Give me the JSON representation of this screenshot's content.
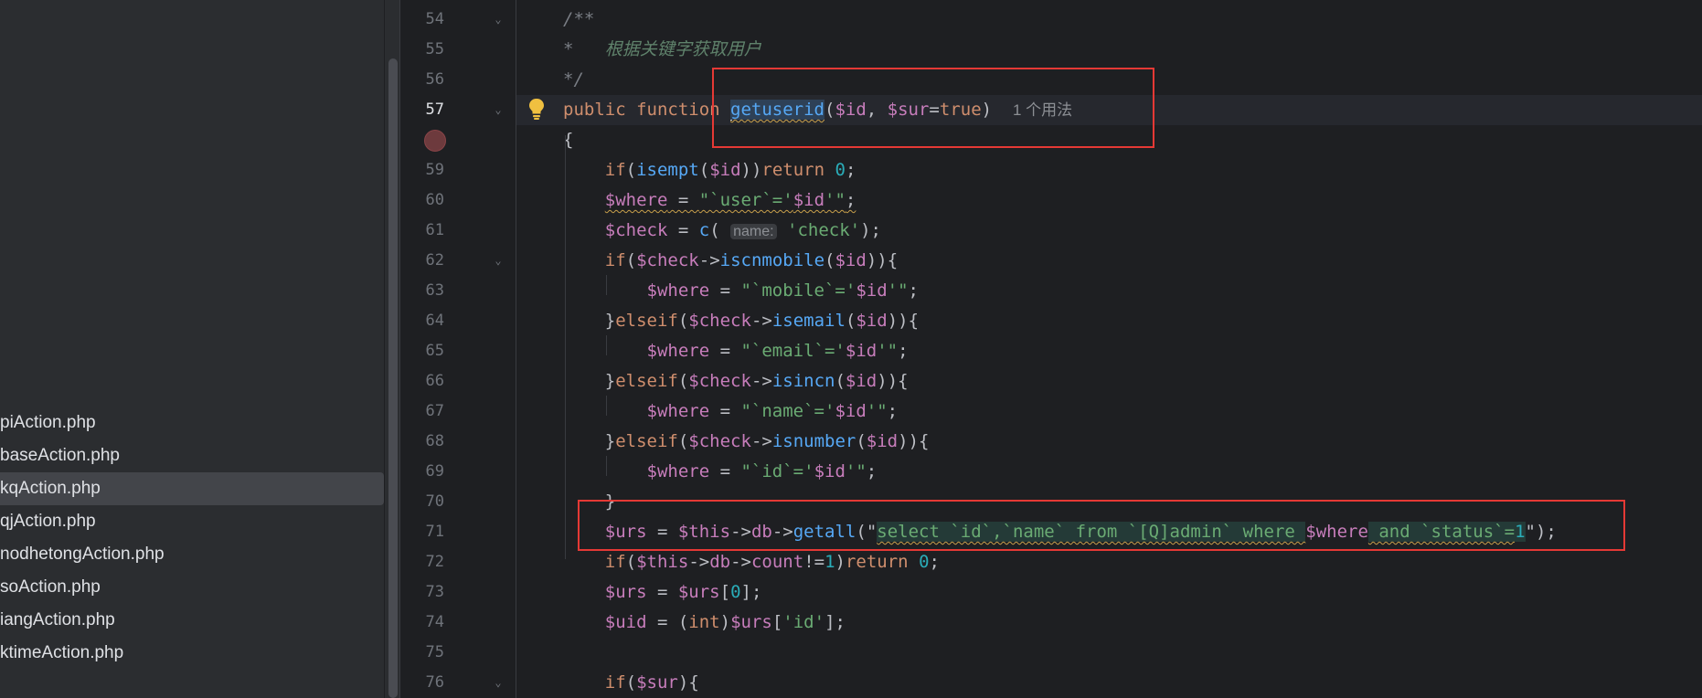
{
  "files": [
    {
      "label": "piAction.php",
      "selected": false
    },
    {
      "label": "baseAction.php",
      "selected": false
    },
    {
      "label": "kqAction.php",
      "selected": true
    },
    {
      "label": "qjAction.php",
      "selected": false
    },
    {
      "label": "nodhetongAction.php",
      "selected": false
    },
    {
      "label": "soAction.php",
      "selected": false
    },
    {
      "label": "iangAction.php",
      "selected": false
    },
    {
      "label": "ktimeAction.php",
      "selected": false
    }
  ],
  "current_line": "57",
  "lines": [
    {
      "n": "54",
      "fold": "⌄",
      "tokens": [
        [
          "cm",
          "/**"
        ]
      ]
    },
    {
      "n": "55",
      "fold": "",
      "tokens": [
        [
          "cm",
          "*   "
        ],
        [
          "cmz",
          "根据关键字获取用户"
        ]
      ]
    },
    {
      "n": "56",
      "fold": "",
      "tokens": [
        [
          "cm",
          "*/"
        ]
      ]
    },
    {
      "n": "57",
      "fold": "⌄",
      "tokens": [
        [
          "kw",
          "public "
        ],
        [
          "kw",
          "function "
        ],
        [
          "caret",
          ""
        ],
        [
          "fn hl-ident wavy",
          "getuserid"
        ],
        [
          "pl",
          "("
        ],
        [
          "vr",
          "$id"
        ],
        [
          "pl",
          ", "
        ],
        [
          "vr",
          "$sur"
        ],
        [
          "pl",
          "="
        ],
        [
          "kw",
          "true"
        ],
        [
          "pl",
          ")  "
        ],
        [
          "usage",
          "1 个用法"
        ]
      ]
    },
    {
      "n": "",
      "fold": "",
      "tokens": [
        [
          "pl",
          "{"
        ]
      ]
    },
    {
      "n": "59",
      "fold": "",
      "tokens": [
        [
          "pl",
          "    "
        ],
        [
          "kw",
          "if"
        ],
        [
          "pl",
          "("
        ],
        [
          "fn",
          "isempt"
        ],
        [
          "pl",
          "("
        ],
        [
          "vr",
          "$id"
        ],
        [
          "pl",
          "))"
        ],
        [
          "kw",
          "return "
        ],
        [
          "nm",
          "0"
        ],
        [
          "pl",
          ";"
        ]
      ]
    },
    {
      "n": "60",
      "fold": "",
      "tokens": [
        [
          "pl",
          "    "
        ],
        [
          "vr wavy",
          "$where"
        ],
        [
          "pl wavy",
          " = "
        ],
        [
          "st wavy",
          "\"`user`='"
        ],
        [
          "vr wavy",
          "$id"
        ],
        [
          "st wavy",
          "'\""
        ],
        [
          "pl wavy",
          ";"
        ]
      ]
    },
    {
      "n": "61",
      "fold": "",
      "tokens": [
        [
          "pl",
          "    "
        ],
        [
          "vr",
          "$check"
        ],
        [
          "pl",
          " = "
        ],
        [
          "fn",
          "c"
        ],
        [
          "pl",
          "( "
        ],
        [
          "hint",
          "name:"
        ],
        [
          "pl",
          " "
        ],
        [
          "st",
          "'check'"
        ],
        [
          "pl",
          ");"
        ]
      ]
    },
    {
      "n": "62",
      "fold": "⌄",
      "tokens": [
        [
          "pl",
          "    "
        ],
        [
          "kw",
          "if"
        ],
        [
          "pl",
          "("
        ],
        [
          "vr",
          "$check"
        ],
        [
          "pl",
          "->"
        ],
        [
          "fn",
          "iscnmobile"
        ],
        [
          "pl",
          "("
        ],
        [
          "vr",
          "$id"
        ],
        [
          "pl",
          "))"
        ],
        [
          "pl",
          "{"
        ]
      ]
    },
    {
      "n": "63",
      "fold": "",
      "tokens": [
        [
          "pl",
          "        "
        ],
        [
          "vr",
          "$where"
        ],
        [
          "pl",
          " = "
        ],
        [
          "st",
          "\"`mobile`='"
        ],
        [
          "vr",
          "$id"
        ],
        [
          "st",
          "'\""
        ],
        [
          "pl",
          ";"
        ]
      ]
    },
    {
      "n": "64",
      "fold": "",
      "tokens": [
        [
          "pl",
          "    }"
        ],
        [
          "kw",
          "elseif"
        ],
        [
          "pl",
          "("
        ],
        [
          "vr",
          "$check"
        ],
        [
          "pl",
          "->"
        ],
        [
          "fn",
          "isemail"
        ],
        [
          "pl",
          "("
        ],
        [
          "vr",
          "$id"
        ],
        [
          "pl",
          "))"
        ],
        [
          "pl",
          "{"
        ]
      ]
    },
    {
      "n": "65",
      "fold": "",
      "tokens": [
        [
          "pl",
          "        "
        ],
        [
          "vr",
          "$where"
        ],
        [
          "pl",
          " = "
        ],
        [
          "st",
          "\"`email`='"
        ],
        [
          "vr",
          "$id"
        ],
        [
          "st",
          "'\""
        ],
        [
          "pl",
          ";"
        ]
      ]
    },
    {
      "n": "66",
      "fold": "",
      "tokens": [
        [
          "pl",
          "    }"
        ],
        [
          "kw",
          "elseif"
        ],
        [
          "pl",
          "("
        ],
        [
          "vr",
          "$check"
        ],
        [
          "pl",
          "->"
        ],
        [
          "fn",
          "isincn"
        ],
        [
          "pl",
          "("
        ],
        [
          "vr",
          "$id"
        ],
        [
          "pl",
          "))"
        ],
        [
          "pl",
          "{"
        ]
      ]
    },
    {
      "n": "67",
      "fold": "",
      "tokens": [
        [
          "pl",
          "        "
        ],
        [
          "vr",
          "$where"
        ],
        [
          "pl",
          " = "
        ],
        [
          "st",
          "\"`name`='"
        ],
        [
          "vr",
          "$id"
        ],
        [
          "st",
          "'\""
        ],
        [
          "pl",
          ";"
        ]
      ]
    },
    {
      "n": "68",
      "fold": "",
      "tokens": [
        [
          "pl",
          "    }"
        ],
        [
          "kw",
          "elseif"
        ],
        [
          "pl",
          "("
        ],
        [
          "vr",
          "$check"
        ],
        [
          "pl",
          "->"
        ],
        [
          "fn",
          "isnumber"
        ],
        [
          "pl",
          "("
        ],
        [
          "vr",
          "$id"
        ],
        [
          "pl",
          "))"
        ],
        [
          "pl",
          "{"
        ]
      ]
    },
    {
      "n": "69",
      "fold": "",
      "tokens": [
        [
          "pl",
          "        "
        ],
        [
          "vr",
          "$where"
        ],
        [
          "pl",
          " = "
        ],
        [
          "st",
          "\"`id`='"
        ],
        [
          "vr",
          "$id"
        ],
        [
          "st",
          "'\""
        ],
        [
          "pl",
          ";"
        ]
      ]
    },
    {
      "n": "70",
      "fold": "",
      "tokens": [
        [
          "pl",
          "    }"
        ]
      ]
    },
    {
      "n": "71",
      "fold": "",
      "tokens": [
        [
          "pl",
          "    "
        ],
        [
          "vr",
          "$urs"
        ],
        [
          "pl",
          " = "
        ],
        [
          "vr",
          "$this"
        ],
        [
          "pl",
          "->"
        ],
        [
          "vr",
          "db"
        ],
        [
          "pl",
          "->"
        ],
        [
          "fn",
          "getall"
        ],
        [
          "pl",
          "(\""
        ],
        [
          "st sq wavy",
          "select `id`,`name` from `[Q]admin` where "
        ],
        [
          "vr",
          "$where"
        ],
        [
          "st sq wavy",
          " and `status`="
        ],
        [
          "nm sq",
          "1"
        ],
        [
          "pl",
          "\");"
        ]
      ]
    },
    {
      "n": "72",
      "fold": "",
      "tokens": [
        [
          "pl",
          "    "
        ],
        [
          "kw",
          "if"
        ],
        [
          "pl",
          "("
        ],
        [
          "vr",
          "$this"
        ],
        [
          "pl",
          "->"
        ],
        [
          "vr",
          "db"
        ],
        [
          "pl",
          "->"
        ],
        [
          "vr",
          "count"
        ],
        [
          "pl",
          "!="
        ],
        [
          "nm",
          "1"
        ],
        [
          "pl",
          ")"
        ],
        [
          "kw",
          "return "
        ],
        [
          "nm",
          "0"
        ],
        [
          "pl",
          ";"
        ]
      ]
    },
    {
      "n": "73",
      "fold": "",
      "tokens": [
        [
          "pl",
          "    "
        ],
        [
          "vr",
          "$urs"
        ],
        [
          "pl",
          " = "
        ],
        [
          "vr",
          "$urs"
        ],
        [
          "pl",
          "["
        ],
        [
          "nm",
          "0"
        ],
        [
          "pl",
          "];"
        ]
      ]
    },
    {
      "n": "74",
      "fold": "",
      "tokens": [
        [
          "pl",
          "    "
        ],
        [
          "vr",
          "$uid"
        ],
        [
          "pl",
          " = ("
        ],
        [
          "kw",
          "int"
        ],
        [
          "pl",
          ")"
        ],
        [
          "vr",
          "$urs"
        ],
        [
          "pl",
          "["
        ],
        [
          "st",
          "'id'"
        ],
        [
          "pl",
          "];"
        ]
      ]
    },
    {
      "n": "75",
      "fold": "",
      "tokens": []
    },
    {
      "n": "76",
      "fold": "⌄",
      "tokens": [
        [
          "pl",
          "    "
        ],
        [
          "kw",
          "if"
        ],
        [
          "pl",
          "("
        ],
        [
          "vr",
          "$sur"
        ],
        [
          "pl",
          "){"
        ]
      ]
    }
  ],
  "icons": {
    "bulb": "lightbulb-icon",
    "breakpoint": "breakpoint-icon",
    "fold": "fold-chevron-icon"
  },
  "colors": {
    "annotation_box": "#e53935",
    "keyword": "#cf8e6d",
    "function": "#56a8f5",
    "variable": "#c77dbb",
    "string": "#6aab73",
    "number": "#2aacb8"
  }
}
